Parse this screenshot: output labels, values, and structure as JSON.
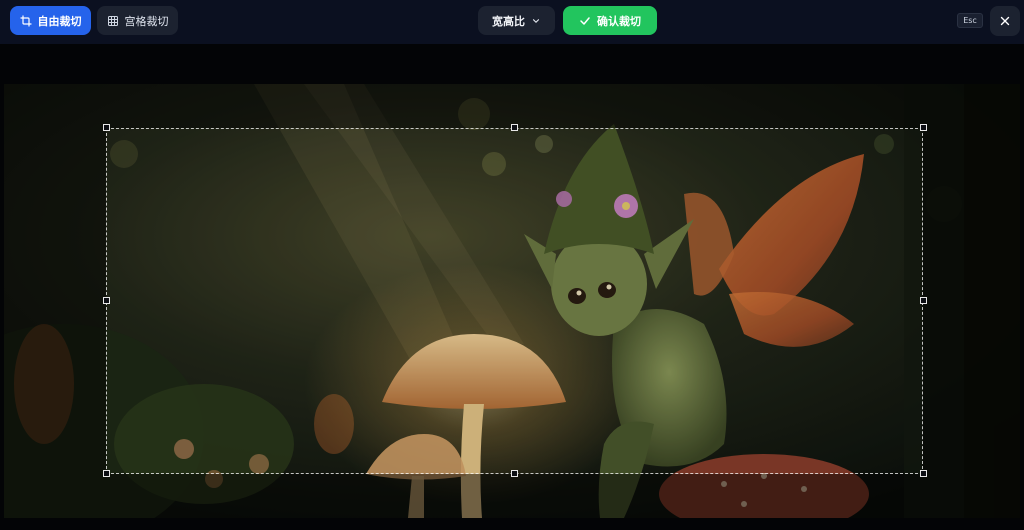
{
  "toolbar": {
    "free_crop_label": "自由裁切",
    "grid_crop_label": "宫格裁切",
    "aspect_ratio_label": "宽高比",
    "confirm_label": "确认裁切",
    "esc_label": "Esc"
  },
  "icons": {
    "free_crop": "crop-icon",
    "grid_crop": "grid-icon",
    "aspect_ratio_dropdown": "chevron-down-icon",
    "confirm": "check-icon",
    "close": "close-icon"
  },
  "colors": {
    "primary": "#2563eb",
    "confirm": "#22c55e",
    "toolbar_bg": "#0b1020",
    "button_bg": "#1c2230"
  }
}
